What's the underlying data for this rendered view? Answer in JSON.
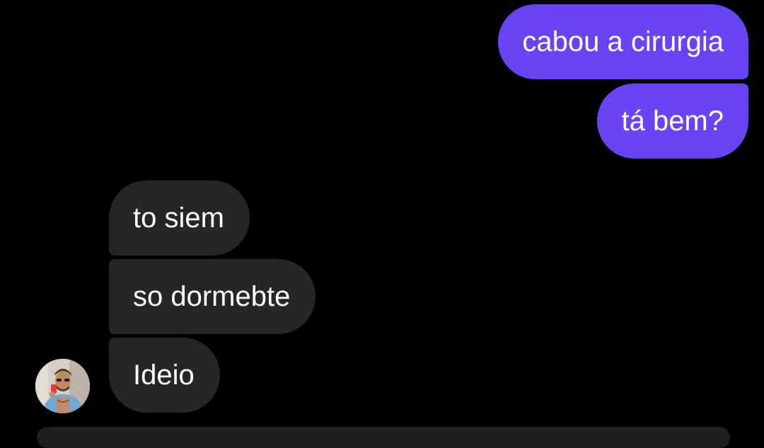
{
  "conversation": {
    "messages": [
      {
        "direction": "outgoing",
        "text": "cabou a cirurgia"
      },
      {
        "direction": "outgoing",
        "text": "tá bem?"
      },
      {
        "direction": "incoming",
        "text": "to siem"
      },
      {
        "direction": "incoming",
        "text": "so dormebte"
      },
      {
        "direction": "incoming",
        "text": "Ideio"
      }
    ]
  },
  "avatar": {
    "icon": "profile-photo"
  },
  "colors": {
    "background": "#000000",
    "outgoing_bubble": "#6844f5",
    "incoming_bubble": "#262626",
    "text": "#ffffff"
  }
}
